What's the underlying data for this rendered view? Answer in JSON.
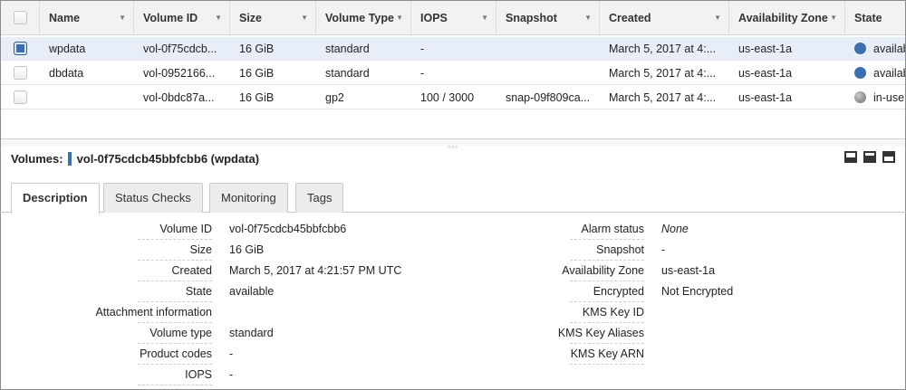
{
  "columns": [
    {
      "key": "name",
      "label": "Name"
    },
    {
      "key": "volume_id",
      "label": "Volume ID"
    },
    {
      "key": "size",
      "label": "Size"
    },
    {
      "key": "volume_type",
      "label": "Volume Type"
    },
    {
      "key": "iops",
      "label": "IOPS"
    },
    {
      "key": "snapshot",
      "label": "Snapshot"
    },
    {
      "key": "created",
      "label": "Created"
    },
    {
      "key": "az",
      "label": "Availability Zone"
    },
    {
      "key": "state",
      "label": "State"
    }
  ],
  "rows": [
    {
      "selected": true,
      "name": "wpdata",
      "volume_id": "vol-0f75cdcb...",
      "size": "16 GiB",
      "volume_type": "standard",
      "iops": "-",
      "snapshot": "",
      "created": "March 5, 2017 at 4:...",
      "az": "us-east-1a",
      "state": "availab",
      "state_color": "#3b6fb0"
    },
    {
      "selected": false,
      "name": "dbdata",
      "volume_id": "vol-0952166...",
      "size": "16 GiB",
      "volume_type": "standard",
      "iops": "-",
      "snapshot": "",
      "created": "March 5, 2017 at 4:...",
      "az": "us-east-1a",
      "state": "availab",
      "state_color": "#3b6fb0"
    },
    {
      "selected": false,
      "name": "",
      "volume_id": "vol-0bdc87a...",
      "size": "16 GiB",
      "volume_type": "gp2",
      "iops": "100 / 3000",
      "snapshot": "snap-09f809ca...",
      "created": "March 5, 2017 at 4:...",
      "az": "us-east-1a",
      "state": "in-use",
      "state_color": "#8a8a8a"
    }
  ],
  "details": {
    "title_prefix": "Volumes:",
    "title_value": "vol-0f75cdcb45bbfcbb6 (wpdata)",
    "tabs": [
      "Description",
      "Status Checks",
      "Monitoring",
      "Tags"
    ],
    "active_tab": "Description",
    "left": [
      {
        "label": "Volume ID",
        "value": "vol-0f75cdcb45bbfcbb6"
      },
      {
        "label": "Size",
        "value": "16 GiB"
      },
      {
        "label": "Created",
        "value": "March 5, 2017 at 4:21:57 PM UTC"
      },
      {
        "label": "State",
        "value": "available"
      },
      {
        "label": "Attachment information",
        "value": ""
      },
      {
        "label": "Volume type",
        "value": "standard"
      },
      {
        "label": "Product codes",
        "value": "-"
      },
      {
        "label": "IOPS",
        "value": "-"
      }
    ],
    "right": [
      {
        "label": "Alarm status",
        "value": "None",
        "italic": true
      },
      {
        "label": "Snapshot",
        "value": "-"
      },
      {
        "label": "Availability Zone",
        "value": "us-east-1a"
      },
      {
        "label": "Encrypted",
        "value": "Not Encrypted"
      },
      {
        "label": "KMS Key ID",
        "value": ""
      },
      {
        "label": "KMS Key Aliases",
        "value": ""
      },
      {
        "label": "KMS Key ARN",
        "value": ""
      }
    ]
  },
  "icons": {
    "sort": "sort-caret-icon",
    "panel": [
      "panel-bottom-small-icon",
      "panel-bottom-large-icon",
      "panel-top-icon"
    ]
  }
}
